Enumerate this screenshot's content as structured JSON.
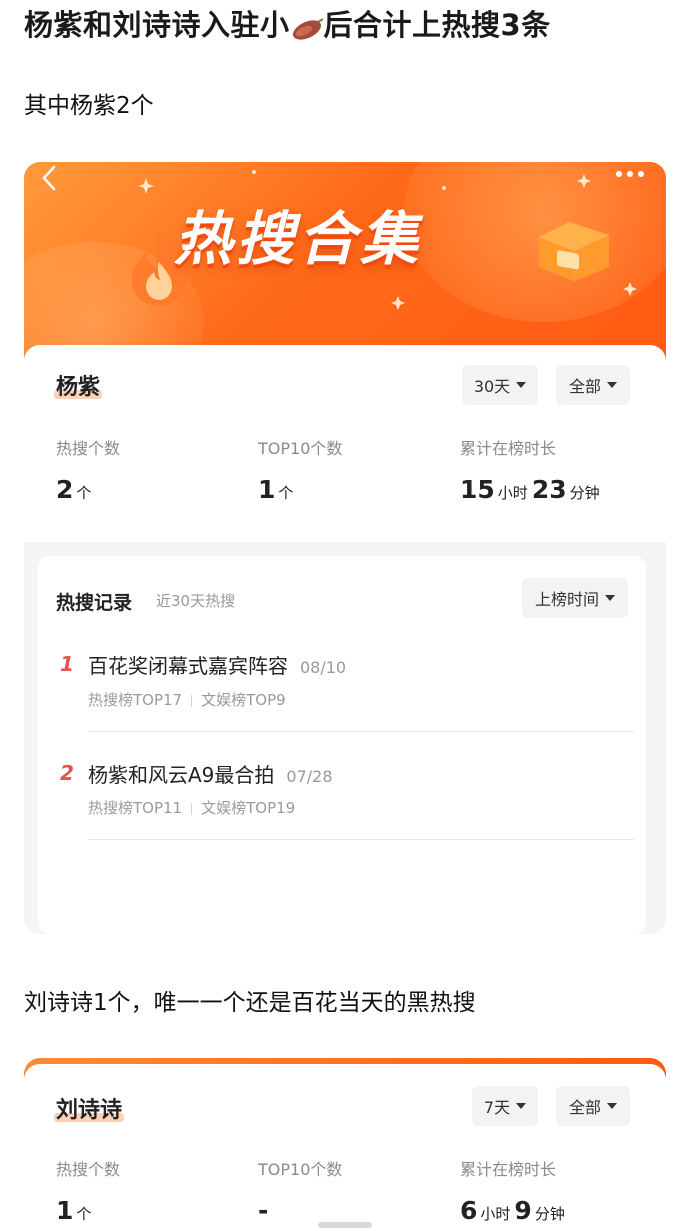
{
  "post": {
    "title_part1": "杨紫和刘诗诗入驻小",
    "title_part2": "后合计上热搜3条",
    "line1": "其中杨紫2个",
    "line2": "刘诗诗1个，唯一一个还是百花当天的黑热搜"
  },
  "banner": {
    "title": "热搜合集"
  },
  "card1": {
    "name": "杨紫",
    "filter_days": "30天",
    "filter_scope": "全部",
    "stats": {
      "count_label": "热搜个数",
      "count_value": "2",
      "count_unit": "个",
      "top10_label": "TOP10个数",
      "top10_value": "1",
      "top10_unit": "个",
      "duration_label": "累计在榜时长",
      "hours_value": "15",
      "hours_unit": "小时",
      "minutes_value": "23",
      "minutes_unit": "分钟"
    },
    "records": {
      "title": "热搜记录",
      "subtitle": "近30天热搜",
      "sort_label": "上榜时间",
      "items": [
        {
          "rank": "1",
          "title": "百花奖闭幕式嘉宾阵容",
          "date": "08/10",
          "tag1": "热搜榜TOP17",
          "tag2": "文娱榜TOP9"
        },
        {
          "rank": "2",
          "title": "杨紫和风云A9最合拍",
          "date": "07/28",
          "tag1": "热搜榜TOP11",
          "tag2": "文娱榜TOP19"
        }
      ]
    }
  },
  "card2": {
    "name": "刘诗诗",
    "filter_days": "7天",
    "filter_scope": "全部",
    "stats": {
      "count_label": "热搜个数",
      "count_value": "1",
      "count_unit": "个",
      "top10_label": "TOP10个数",
      "top10_value": "-",
      "duration_label": "累计在榜时长",
      "hours_value": "6",
      "hours_unit": "小时",
      "minutes_value": "9",
      "minutes_unit": "分钟"
    }
  },
  "colors": {
    "accent_orange": "#ff6a1a",
    "rank_red": "#e5534b",
    "highlight": "#ffd2b8"
  }
}
